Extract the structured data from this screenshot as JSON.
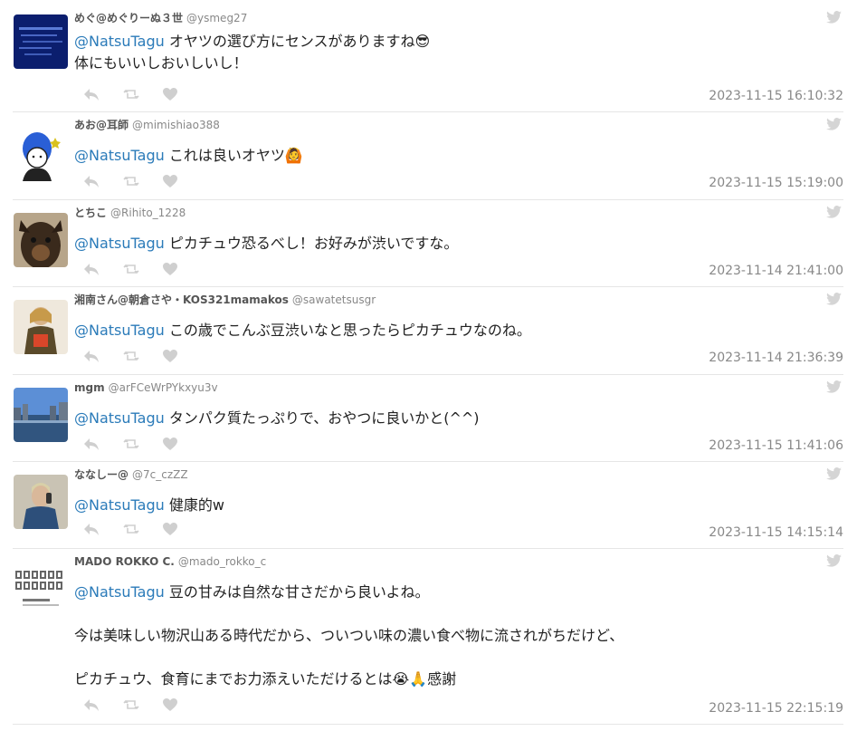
{
  "colors": {
    "mention": "#2b7bb9",
    "icon": "#cfcfcf",
    "divider": "#e6e6e6"
  },
  "tweets": [
    {
      "name": "めぐ@めぐりーぬ３世",
      "handle": "@ysmeg27",
      "mention": "@NatsuTagu",
      "text": " オヤツの選び方にセンスがありますね😎\n体にもいいしおいしいし！",
      "time": "2023-11-15 16:10:32"
    },
    {
      "name": "あお@耳師",
      "handle": "@mimishiao388",
      "mention": "@NatsuTagu",
      "text": " これは良いオヤツ🙆",
      "time": "2023-11-15 15:19:00"
    },
    {
      "name": "とちこ",
      "handle": "@Rihito_1228",
      "mention": "@NatsuTagu",
      "text": " ピカチュウ恐るべし！お好みが渋いですな。",
      "time": "2023-11-14 21:41:00"
    },
    {
      "name": "湘南さん@朝倉さや・KOS321mamakos",
      "handle": "@sawatetsusgr",
      "mention": "@NatsuTagu",
      "text": " この歳でこんぶ豆渋いなと思ったらピカチュウなのね。",
      "time": "2023-11-14 21:36:39"
    },
    {
      "name": "mgm",
      "handle": "@arFCeWrPYkxyu3v",
      "mention": "@NatsuTagu",
      "text": " タンパク質たっぷりで、おやつに良いかと(^^)",
      "time": "2023-11-15 11:41:06"
    },
    {
      "name": "ななしー@",
      "handle": "@7c_czZZ",
      "mention": "@NatsuTagu",
      "text": " 健康的w",
      "time": "2023-11-15 14:15:14"
    },
    {
      "name": "MADO ROKKO C.",
      "handle": "@mado_rokko_c",
      "mention": "@NatsuTagu",
      "text": " 豆の甘みは自然な甘さだから良いよね。\n\n今は美味しい物沢山ある時代だから、ついつい味の濃い食べ物に流されがちだけど、\n\nピカチュウ、食育にまでお力添えいただけるとは😭🙏感謝",
      "time": "2023-11-15 22:15:19",
      "avatar_caption": "MADO ROKKO C."
    }
  ]
}
